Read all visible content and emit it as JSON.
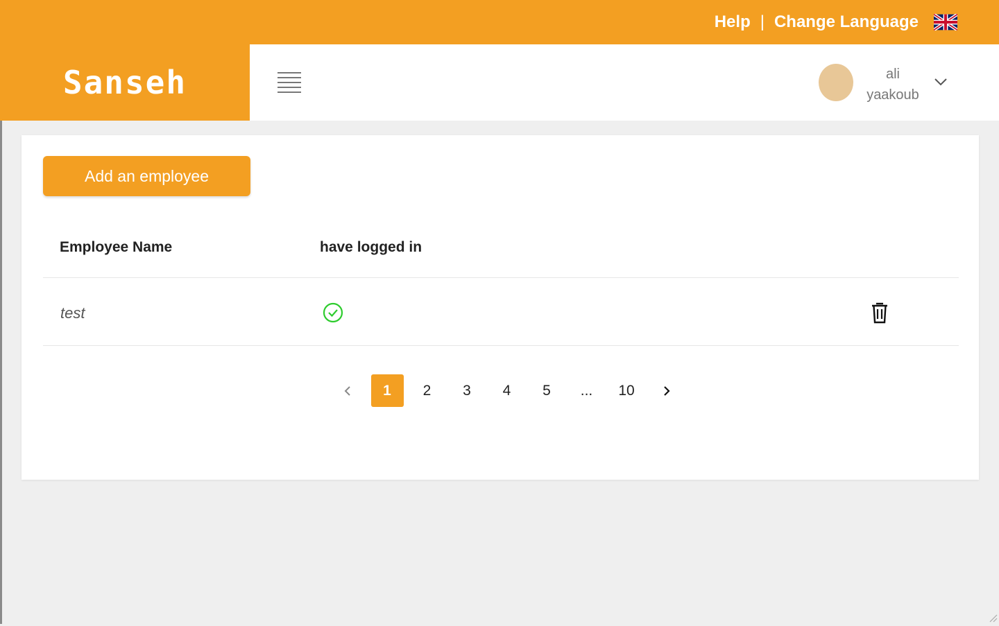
{
  "topbar": {
    "help_label": "Help",
    "separator": "|",
    "change_language_label": "Change Language",
    "flag_icon": "uk-flag-icon"
  },
  "brand": {
    "logo_text": "Sanseh",
    "accent_color": "#f39f22"
  },
  "header": {
    "menu_icon": "hamburger-icon",
    "user": {
      "first_name": "ali",
      "last_name": "yaakoub",
      "dropdown_icon": "chevron-down-icon"
    }
  },
  "main": {
    "add_button_label": "Add an employee",
    "table": {
      "columns": [
        "Employee Name",
        "have logged in"
      ],
      "rows": [
        {
          "name": "test",
          "logged_in": true,
          "delete_icon": "trash-icon"
        }
      ]
    },
    "pagination": {
      "prev_icon": "chevron-left-icon",
      "next_icon": "chevron-right-icon",
      "pages": [
        "1",
        "2",
        "3",
        "4",
        "5",
        "...",
        "10"
      ],
      "current": "1"
    }
  }
}
